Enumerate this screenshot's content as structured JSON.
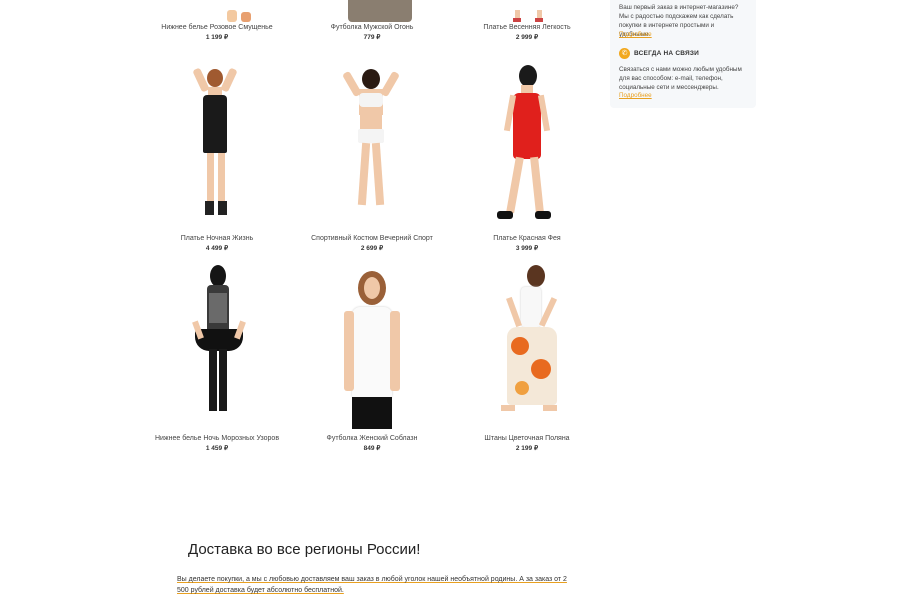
{
  "products": [
    {
      "name": "Нижнее белье Розовое Смущенье",
      "price": "1 199 ₽"
    },
    {
      "name": "Футболка Мужской Огонь",
      "price": "779 ₽"
    },
    {
      "name": "Платье Весенняя Легкость",
      "price": "2 999 ₽"
    },
    {
      "name": "Платье Ночная Жизнь",
      "price": "4 499 ₽"
    },
    {
      "name": "Спортивный Костюм Вечерний Спорт",
      "price": "2 699 ₽"
    },
    {
      "name": "Платье Красная Фея",
      "price": "3 999 ₽"
    },
    {
      "name": "Нижнее белье Ночь Морозных Узоров",
      "price": "1 459 ₽"
    },
    {
      "name": "Футболка Женский Соблазн",
      "price": "849 ₽"
    },
    {
      "name": "Штаны Цветочная Поляна",
      "price": "2 199 ₽"
    }
  ],
  "sidebar": {
    "first_order_text": "Ваш первый заказ в интернет-магазине? Мы с радостью подскажем как сделать покупки в интернете простыми и удобными.",
    "first_order_link": "Подробнее",
    "contact_title": "ВСЕГДА НА СВЯЗИ",
    "contact_icon": "phone-icon",
    "contact_text": "Связаться с нами можно любым удобным для вас способом: e-mail, телефон, социальные сети и мессенджеры.",
    "contact_link": "Подробнее",
    "accent_color": "#f2a81d"
  },
  "delivery": {
    "title": "Доставка во все регионы России!",
    "text": "Вы делаете покупки, а мы с любовью доставляем ваш заказ в любой уголок нашей необъятной родины. А за заказ от 2 500 рублей доставка будет абсолютно бесплатной."
  }
}
